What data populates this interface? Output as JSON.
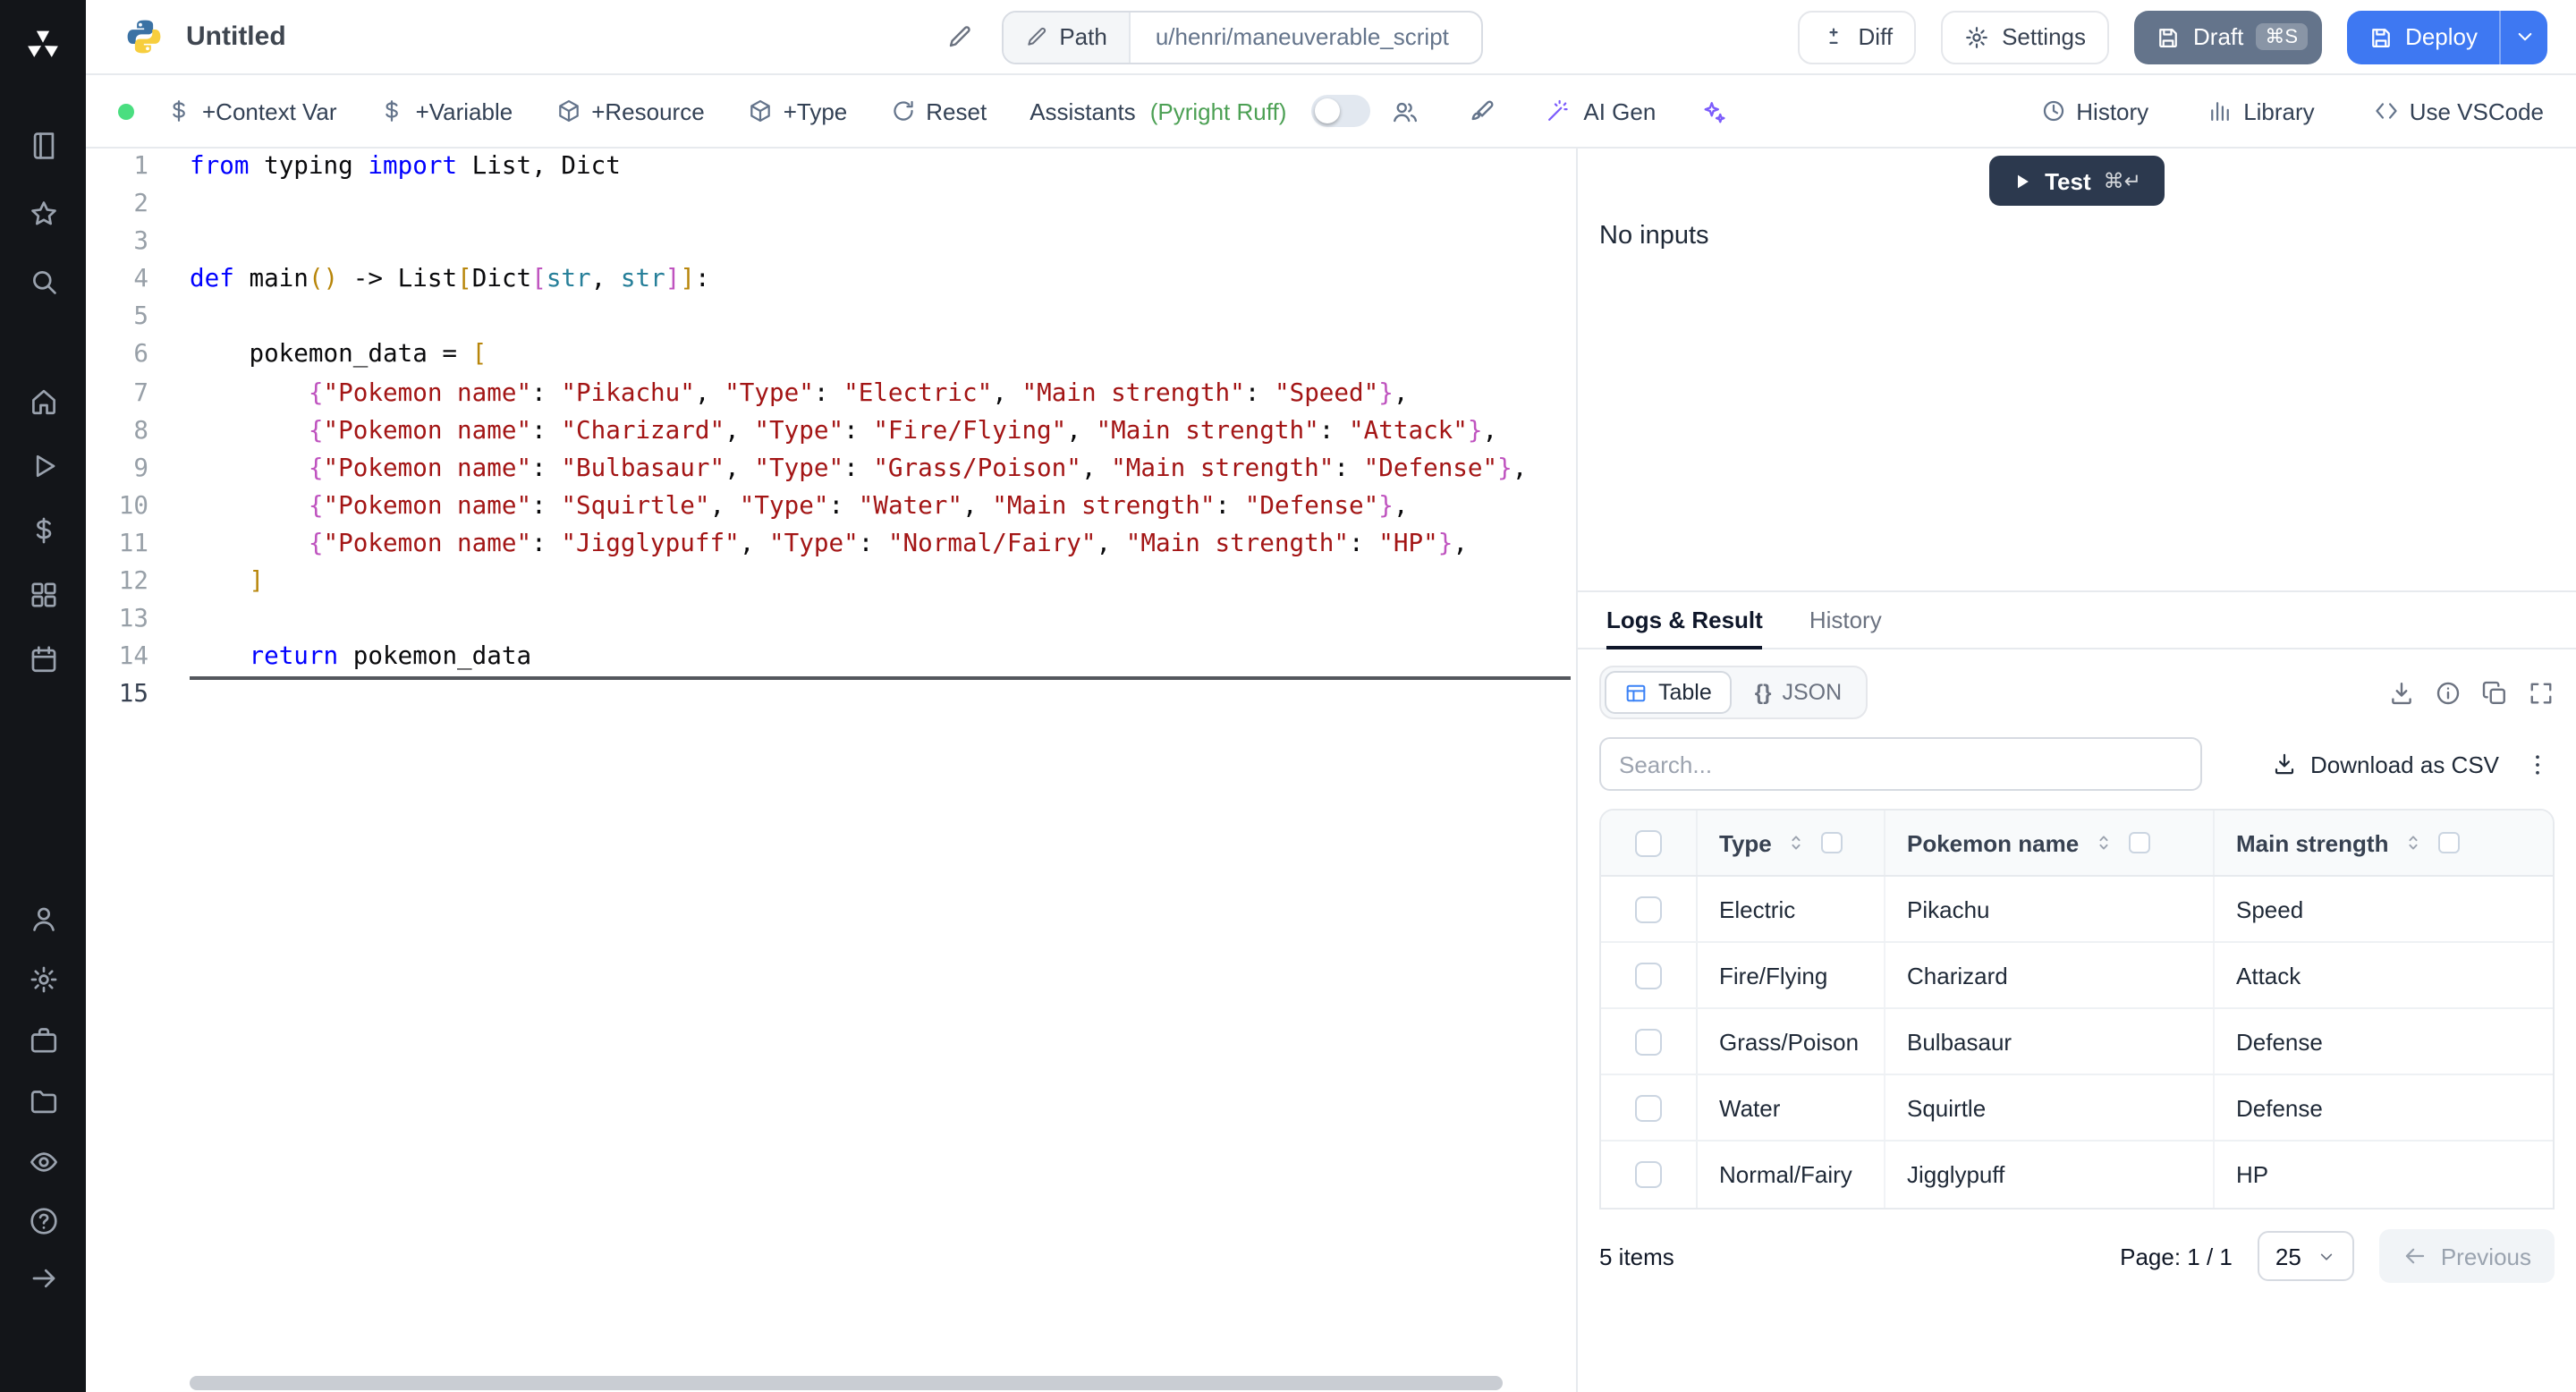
{
  "topbar": {
    "title": "Untitled",
    "path_label": "Path",
    "path_value": "u/henri/maneuverable_script",
    "diff_label": "Diff",
    "settings_label": "Settings",
    "draft_label": "Draft",
    "draft_kbd": "⌘S",
    "deploy_label": "Deploy"
  },
  "toolbar": {
    "context_var": "+Context Var",
    "variable": "+Variable",
    "resource": "+Resource",
    "type": "+Type",
    "reset": "Reset",
    "assistants": "Assistants",
    "assistants_detail": "(Pyright Ruff)",
    "ai_gen": "AI Gen",
    "history": "History",
    "library": "Library",
    "use_vscode": "Use VSCode"
  },
  "sidebar": {
    "groups": [
      [
        "book",
        "star",
        "search"
      ],
      [
        "home",
        "play",
        "dollar",
        "blocks",
        "calendar"
      ],
      [
        "user",
        "gear",
        "briefcase",
        "folder",
        "eye"
      ],
      [
        "help",
        "arrow-right"
      ]
    ]
  },
  "editor": {
    "language": "python",
    "lines": [
      [
        [
          "k",
          "from"
        ],
        [
          "p",
          " typing "
        ],
        [
          "k",
          "import"
        ],
        [
          "p",
          " List, Dict"
        ]
      ],
      [],
      [],
      [
        [
          "k",
          "def"
        ],
        [
          "p",
          " main"
        ],
        [
          "b1",
          "()"
        ],
        [
          "p",
          " -> List"
        ],
        [
          "b1",
          "["
        ],
        [
          "p",
          "Dict"
        ],
        [
          "b2",
          "["
        ],
        [
          "t",
          "str"
        ],
        [
          "p",
          ", "
        ],
        [
          "t",
          "str"
        ],
        [
          "b2",
          "]"
        ],
        [
          "b1",
          "]"
        ],
        [
          "p",
          ":"
        ]
      ],
      [],
      [
        [
          "p",
          "    pokemon_data = "
        ],
        [
          "b1",
          "["
        ]
      ],
      [
        [
          "p",
          "        "
        ],
        [
          "b2",
          "{"
        ],
        [
          "s",
          "\"Pokemon name\""
        ],
        [
          "p",
          ": "
        ],
        [
          "s",
          "\"Pikachu\""
        ],
        [
          "p",
          ", "
        ],
        [
          "s",
          "\"Type\""
        ],
        [
          "p",
          ": "
        ],
        [
          "s",
          "\"Electric\""
        ],
        [
          "p",
          ", "
        ],
        [
          "s",
          "\"Main strength\""
        ],
        [
          "p",
          ": "
        ],
        [
          "s",
          "\"Speed\""
        ],
        [
          "b2",
          "}"
        ],
        [
          "p",
          ","
        ]
      ],
      [
        [
          "p",
          "        "
        ],
        [
          "b2",
          "{"
        ],
        [
          "s",
          "\"Pokemon name\""
        ],
        [
          "p",
          ": "
        ],
        [
          "s",
          "\"Charizard\""
        ],
        [
          "p",
          ", "
        ],
        [
          "s",
          "\"Type\""
        ],
        [
          "p",
          ": "
        ],
        [
          "s",
          "\"Fire/Flying\""
        ],
        [
          "p",
          ", "
        ],
        [
          "s",
          "\"Main strength\""
        ],
        [
          "p",
          ": "
        ],
        [
          "s",
          "\"Attack\""
        ],
        [
          "b2",
          "}"
        ],
        [
          "p",
          ","
        ]
      ],
      [
        [
          "p",
          "        "
        ],
        [
          "b2",
          "{"
        ],
        [
          "s",
          "\"Pokemon name\""
        ],
        [
          "p",
          ": "
        ],
        [
          "s",
          "\"Bulbasaur\""
        ],
        [
          "p",
          ", "
        ],
        [
          "s",
          "\"Type\""
        ],
        [
          "p",
          ": "
        ],
        [
          "s",
          "\"Grass/Poison\""
        ],
        [
          "p",
          ", "
        ],
        [
          "s",
          "\"Main strength\""
        ],
        [
          "p",
          ": "
        ],
        [
          "s",
          "\"Defense\""
        ],
        [
          "b2",
          "}"
        ],
        [
          "p",
          ","
        ]
      ],
      [
        [
          "p",
          "        "
        ],
        [
          "b2",
          "{"
        ],
        [
          "s",
          "\"Pokemon name\""
        ],
        [
          "p",
          ": "
        ],
        [
          "s",
          "\"Squirtle\""
        ],
        [
          "p",
          ", "
        ],
        [
          "s",
          "\"Type\""
        ],
        [
          "p",
          ": "
        ],
        [
          "s",
          "\"Water\""
        ],
        [
          "p",
          ", "
        ],
        [
          "s",
          "\"Main strength\""
        ],
        [
          "p",
          ": "
        ],
        [
          "s",
          "\"Defense\""
        ],
        [
          "b2",
          "}"
        ],
        [
          "p",
          ","
        ]
      ],
      [
        [
          "p",
          "        "
        ],
        [
          "b2",
          "{"
        ],
        [
          "s",
          "\"Pokemon name\""
        ],
        [
          "p",
          ": "
        ],
        [
          "s",
          "\"Jigglypuff\""
        ],
        [
          "p",
          ", "
        ],
        [
          "s",
          "\"Type\""
        ],
        [
          "p",
          ": "
        ],
        [
          "s",
          "\"Normal/Fairy\""
        ],
        [
          "p",
          ", "
        ],
        [
          "s",
          "\"Main strength\""
        ],
        [
          "p",
          ": "
        ],
        [
          "s",
          "\"HP\""
        ],
        [
          "b2",
          "}"
        ],
        [
          "p",
          ","
        ]
      ],
      [
        [
          "p",
          "    "
        ],
        [
          "b1",
          "]"
        ]
      ],
      [],
      [
        [
          "p",
          "    "
        ],
        [
          "k",
          "return"
        ],
        [
          "p",
          " pokemon_data"
        ]
      ],
      []
    ]
  },
  "runner": {
    "test_label": "Test",
    "test_kbd": "⌘↵",
    "no_inputs": "No inputs"
  },
  "results": {
    "tabs": [
      "Logs & Result",
      "History"
    ],
    "view_table": "Table",
    "view_json_braces": "{}",
    "view_json": "JSON",
    "search_placeholder": "Search...",
    "download_csv": "Download as CSV",
    "table": {
      "columns": [
        "Type",
        "Pokemon name",
        "Main strength"
      ],
      "rows": [
        [
          "Electric",
          "Pikachu",
          "Speed"
        ],
        [
          "Fire/Flying",
          "Charizard",
          "Attack"
        ],
        [
          "Grass/Poison",
          "Bulbasaur",
          "Defense"
        ],
        [
          "Water",
          "Squirtle",
          "Defense"
        ],
        [
          "Normal/Fairy",
          "Jigglypuff",
          "HP"
        ]
      ]
    },
    "footer": {
      "items": "5 items",
      "page": "Page: 1 / 1",
      "page_size": "25",
      "previous": "Previous"
    }
  },
  "colors": {
    "accent_blue": "#3e78f2",
    "draft_slate": "#64748b",
    "test_navy": "#2c394e",
    "status_green": "#4ade80"
  }
}
